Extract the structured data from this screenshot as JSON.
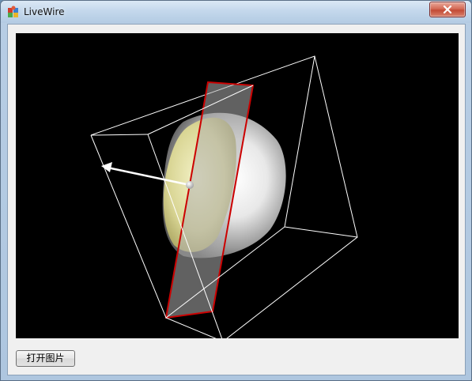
{
  "window": {
    "title": "LiveWire",
    "icon": "app-icon",
    "close_icon": "close-icon"
  },
  "toolbar": {
    "open_image_label": "打开图片"
  },
  "scene": {
    "background": "#000000",
    "bounding_box_color": "#ffffff",
    "slice_plane_color": "#b0b0b0",
    "slice_plane_border_color": "#cc0000",
    "volume_highlight_color": "#e8e6a8"
  }
}
